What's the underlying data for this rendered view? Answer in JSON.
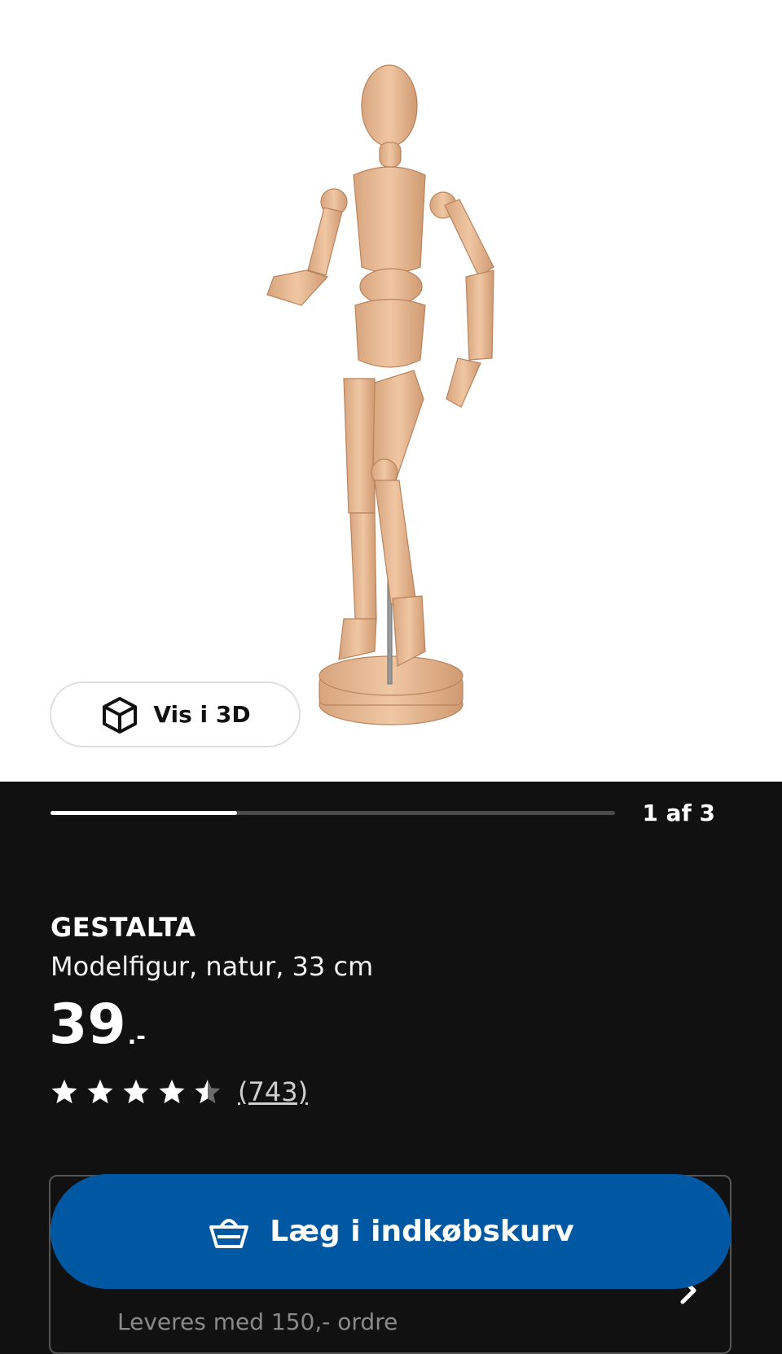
{
  "gallery": {
    "view_3d_label": "Vis i 3D",
    "counter": "1 af 3",
    "progress": 0.33
  },
  "product": {
    "name": "GESTALTA",
    "description": "Modelfigur, natur, 33 cm",
    "price_main": "39",
    "price_suffix": ".-",
    "rating": 4.5,
    "rating_max": 5,
    "review_count": "(743)"
  },
  "actions": {
    "add_to_cart_label": "Læg i indkøbskurv"
  },
  "delivery": {
    "text": "Leveres med 150,- ordre"
  },
  "icons": {
    "view3d": "cube-icon",
    "cart": "shopping-basket-icon",
    "star": "star-icon",
    "chevron": "chevron-right-icon"
  },
  "colors": {
    "background": "#111111",
    "primary_button": "#0058a3",
    "hero_background": "#ffffff"
  }
}
